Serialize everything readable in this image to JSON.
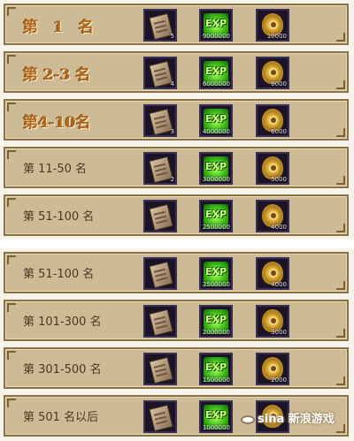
{
  "top_rows": [
    {
      "rank": "第　1　名",
      "book_count": "5",
      "exp": "9000000",
      "medal": "10000"
    },
    {
      "rank": "第 2-3 名",
      "book_count": "4",
      "exp": "6000000",
      "medal": "8000"
    },
    {
      "rank": "第4-10名",
      "book_count": "3",
      "exp": "4000000",
      "medal": "6000"
    },
    {
      "rank": "第 11-50 名",
      "book_count": "2",
      "exp": "3000000",
      "medal": "5000"
    },
    {
      "rank": "第 51-100 名",
      "book_count": "",
      "exp": "2500000",
      "medal": "4000"
    }
  ],
  "bottom_rows": [
    {
      "rank": "第 51-100 名",
      "book_count": "",
      "exp": "2500000",
      "medal": "4000"
    },
    {
      "rank": "第 101-300 名",
      "book_count": "",
      "exp": "2000000",
      "medal": "3000"
    },
    {
      "rank": "第 301-500 名",
      "book_count": "",
      "exp": "1500000",
      "medal": "2000"
    },
    {
      "rank": "第 501 名以后",
      "book_count": "",
      "exp": "1000000",
      "medal": ""
    }
  ],
  "exp_icon_text": "EXP",
  "watermark_text": "sina 新浪游戏",
  "colors": {
    "row_bg": "#cdbb96",
    "accent_gold": "#b06a22",
    "item_bg": "#1c1426"
  },
  "icons": {
    "book": "skill-book-icon",
    "exp": "exp-icon",
    "medal": "medal-icon"
  }
}
